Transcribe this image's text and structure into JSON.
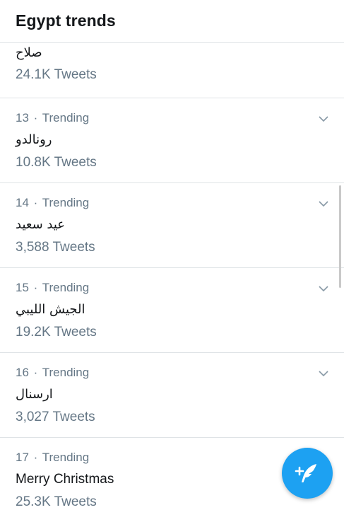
{
  "header": {
    "title": "Egypt trends"
  },
  "partial_item": {
    "name": "صلاح",
    "count": "24.1K Tweets"
  },
  "trends": [
    {
      "rank": "13",
      "sep": "·",
      "label": "Trending",
      "name": "رونالدو",
      "count": "10.8K Tweets"
    },
    {
      "rank": "14",
      "sep": "·",
      "label": "Trending",
      "name": "عيد سعيد",
      "count": "3,588 Tweets"
    },
    {
      "rank": "15",
      "sep": "·",
      "label": "Trending",
      "name": "الجيش الليبي",
      "count": "19.2K Tweets"
    },
    {
      "rank": "16",
      "sep": "·",
      "label": "Trending",
      "name": "ارسنال",
      "count": "3,027 Tweets"
    },
    {
      "rank": "17",
      "sep": "·",
      "label": "Trending",
      "name": "Merry Christmas",
      "count": "25.3K Tweets"
    }
  ],
  "fab": {
    "icon": "compose-tweet-icon",
    "color": "#1da1f2"
  },
  "colors": {
    "secondary_text": "#657786",
    "primary_text": "#14171a",
    "divider": "#dfe3e6"
  }
}
